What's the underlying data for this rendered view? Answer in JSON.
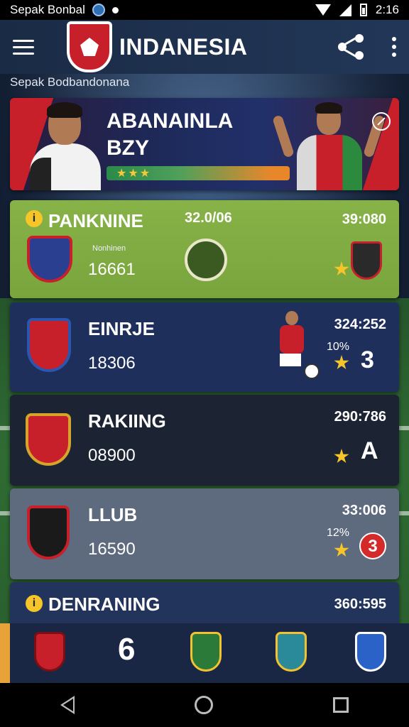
{
  "status_bar": {
    "left_text": "Sepak Bonbal",
    "time": "2:16"
  },
  "app_bar": {
    "title": "INDANESIA",
    "logo_icon": "club-shield-icon",
    "menu_icon": "hamburger-menu-icon",
    "share_icon": "share-icon",
    "overflow_icon": "more-vert-icon"
  },
  "subtitle": "Sepak Bodbandonana",
  "hero": {
    "title_line1": "ABANAINLA",
    "title_line2": "BZY",
    "stars": "★★★"
  },
  "rankings": [
    {
      "name": "PANKNINE",
      "points": "16661",
      "center_value": "32.0/06",
      "score": "39:080",
      "small_label": "Nonhinen",
      "badge": "i"
    },
    {
      "name": "EINRJE",
      "points": "18306",
      "score": "324:252",
      "pct": "10%",
      "rank": "3"
    },
    {
      "name": "RAKIING",
      "points": "08900",
      "score": "290:786",
      "rank": "A"
    },
    {
      "name": "LLUB",
      "points": "16590",
      "score": "33:006",
      "pct": "12%",
      "rank": "3"
    },
    {
      "name": "DENRANING",
      "score": "360:595",
      "badge": "i"
    }
  ],
  "bottom_tabs": {
    "number": "6"
  },
  "colors": {
    "accent_red": "#c8202a",
    "highlight_green": "#86b247",
    "star_gold": "#f6c529"
  }
}
